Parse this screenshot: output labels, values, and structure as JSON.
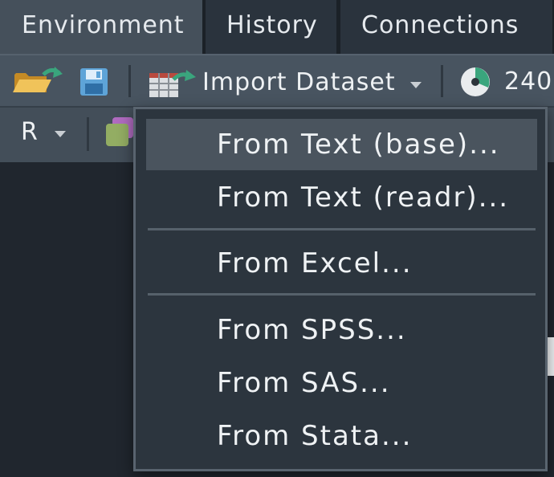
{
  "tabs": [
    {
      "label": "Environment",
      "active": true
    },
    {
      "label": "History",
      "active": false
    },
    {
      "label": "Connections",
      "active": false
    }
  ],
  "toolbar": {
    "open_icon": "open-folder-icon",
    "save_icon": "save-icon",
    "import_icon": "import-table-icon",
    "import_label": "Import Dataset",
    "memory_icon": "memory-pie-icon",
    "memory_label": "240"
  },
  "toolbar2": {
    "language_label": "R",
    "object_icon": "stacked-objects-icon"
  },
  "menu": {
    "items": [
      {
        "label": "From Text (base)...",
        "highlighted": true
      },
      {
        "label": "From Text (readr)..."
      },
      {
        "label": "From Excel..."
      },
      {
        "label": "From SPSS..."
      },
      {
        "label": "From SAS..."
      },
      {
        "label": "From Stata..."
      }
    ]
  },
  "colors": {
    "accent_green": "#3aa57d",
    "icon_blue": "#5ea4d8",
    "folder_yellow": "#e6b94a"
  }
}
